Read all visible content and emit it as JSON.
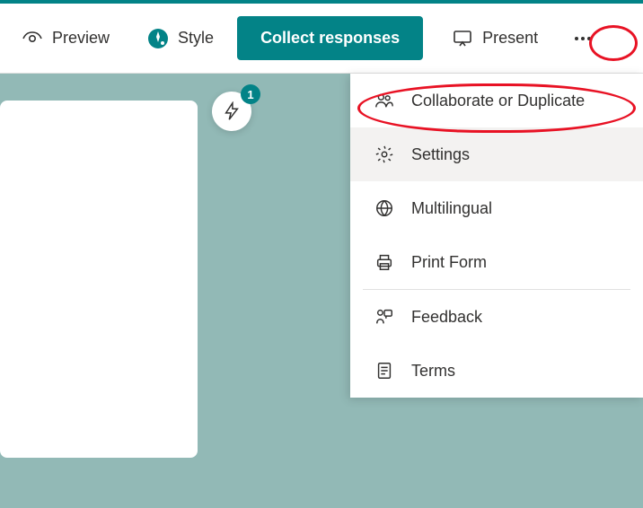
{
  "header": {
    "preview_label": "Preview",
    "style_label": "Style",
    "collect_label": "Collect responses",
    "present_label": "Present"
  },
  "fab": {
    "badge": "1"
  },
  "dropdown": {
    "collaborate": "Collaborate or Duplicate",
    "settings": "Settings",
    "multilingual": "Multilingual",
    "print": "Print Form",
    "feedback": "Feedback",
    "terms": "Terms"
  }
}
